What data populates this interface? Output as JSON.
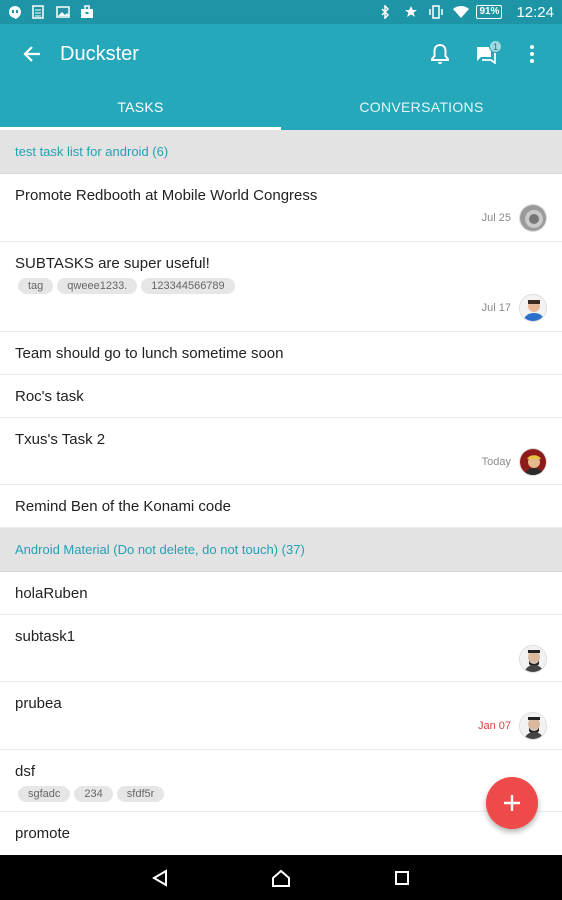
{
  "status_bar": {
    "battery": "91%",
    "time": "12:24"
  },
  "toolbar": {
    "title": "Duckster",
    "badge_count": "1"
  },
  "tabs": [
    {
      "label": "TASKS",
      "active": true
    },
    {
      "label": "CONVERSATIONS",
      "active": false
    }
  ],
  "sections": [
    {
      "header": "test task list for android  (6)",
      "tasks": [
        {
          "title": "Promote Redbooth at Mobile World Congress",
          "date": "Jul 25",
          "avatar": "grey-avatar",
          "tags": []
        },
        {
          "title": "SUBTASKS are super useful!",
          "date": "Jul 17",
          "avatar": "blue-avatar",
          "tags": [
            "tag",
            "qweee1233.",
            "123344566789"
          ]
        },
        {
          "title": "Team should go to lunch sometime soon",
          "date": "",
          "tags": []
        },
        {
          "title": "Roc's task",
          "date": "",
          "tags": []
        },
        {
          "title": "Txus's Task 2",
          "date": "Today",
          "avatar": "red-avatar",
          "tags": []
        },
        {
          "title": "Remind Ben of the Konami code",
          "date": "",
          "tags": []
        }
      ]
    },
    {
      "header": "Android Material (Do not delete, do not touch) (37)",
      "tasks": [
        {
          "title": "holaRuben",
          "date": "",
          "tags": []
        },
        {
          "title": "subtask1",
          "date": "",
          "avatar": "beard-avatar",
          "tags": []
        },
        {
          "title": "prubea",
          "date": "Jan 07",
          "overdue": true,
          "avatar": "beard-avatar",
          "tags": []
        },
        {
          "title": "dsf",
          "date": "",
          "tags": [
            "sgfadc",
            "234",
            "sfdf5r"
          ]
        },
        {
          "title": "promote",
          "date": "",
          "tags": []
        }
      ]
    }
  ],
  "colors": {
    "primary": "#26a8bb",
    "status": "#1e95a6",
    "accent": "#ef4a4a",
    "overdue": "#d8403f",
    "link": "#23a0b4"
  }
}
